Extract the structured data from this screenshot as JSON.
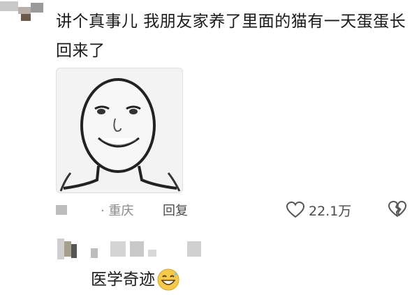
{
  "comment": {
    "text": "讲个真事儿 我朋友家养了里面的猫有一天蛋蛋长回来了",
    "location": "· 重庆",
    "reply_label": "回复",
    "like_count": "22.1万"
  },
  "reply": {
    "text": "医学奇迹"
  },
  "icons": {
    "like": "heart-outline-icon",
    "dislike": "broken-heart-icon",
    "emoji": "grinning-sweat-emoji-icon"
  },
  "colors": {
    "text": "#1a1a1a",
    "meta": "#8a8a8a",
    "emoji": "#f7c948"
  }
}
